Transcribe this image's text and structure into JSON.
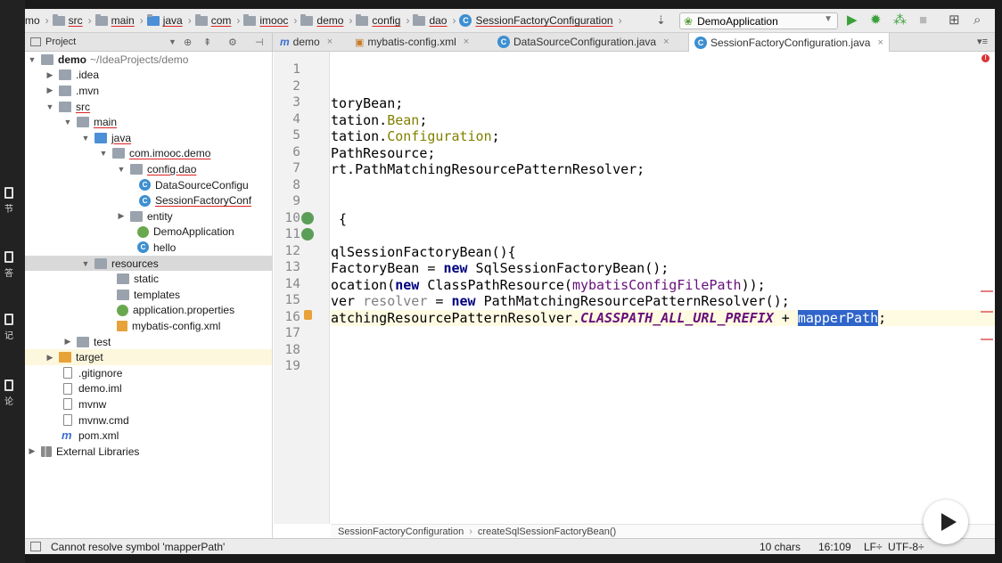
{
  "sidebar": {
    "items": [
      {
        "icon": "chapter-icon",
        "label": "节"
      },
      {
        "icon": "qa-icon",
        "label": "答"
      },
      {
        "icon": "notes-icon",
        "label": "记"
      },
      {
        "icon": "discuss-icon",
        "label": "论"
      }
    ]
  },
  "nav": {
    "crumbs": [
      "mo",
      "src",
      "main",
      "java",
      "com",
      "imooc",
      "demo",
      "config",
      "dao",
      "SessionFactoryConfiguration"
    ],
    "run_config": "DemoApplication"
  },
  "tabs": {
    "project_label": "Project",
    "items": [
      {
        "label": "demo",
        "icon": "m",
        "active": false
      },
      {
        "label": "mybatis-config.xml",
        "icon": "xml",
        "active": false
      },
      {
        "label": "DataSourceConfiguration.java",
        "icon": "class",
        "active": false
      },
      {
        "label": "SessionFactoryConfiguration.java",
        "icon": "class",
        "active": true
      }
    ]
  },
  "tree": {
    "rows": [
      {
        "label": "demo",
        "extra": "~/IdeaProjects/demo"
      },
      {
        "label": ".idea"
      },
      {
        "label": ".mvn"
      },
      {
        "label": "src"
      },
      {
        "label": "main"
      },
      {
        "label": "java"
      },
      {
        "label": "com.imooc.demo"
      },
      {
        "label": "config.dao"
      },
      {
        "label": "DataSourceConfigu"
      },
      {
        "label": "SessionFactoryConf"
      },
      {
        "label": "entity"
      },
      {
        "label": "DemoApplication"
      },
      {
        "label": "hello"
      },
      {
        "label": "resources"
      },
      {
        "label": "static"
      },
      {
        "label": "templates"
      },
      {
        "label": "application.properties"
      },
      {
        "label": "mybatis-config.xml"
      },
      {
        "label": "test"
      },
      {
        "label": "target"
      },
      {
        "label": ".gitignore"
      },
      {
        "label": "demo.iml"
      },
      {
        "label": "mvnw"
      },
      {
        "label": "mvnw.cmd"
      },
      {
        "label": "pom.xml"
      },
      {
        "label": "External Libraries"
      }
    ]
  },
  "editor": {
    "line_numbers": [
      "1",
      "2",
      "3",
      "4",
      "5",
      "6",
      "7",
      "8",
      "9",
      "10",
      "11",
      "12",
      "13",
      "14",
      "15",
      "16",
      "17",
      "18",
      "19"
    ],
    "l3": "toryBean;",
    "l4a": "tation.",
    "l4b": "Bean",
    "l4c": ";",
    "l5a": "tation.",
    "l5b": "Configuration",
    "l5c": ";",
    "l6": "PathResource;",
    "l7": "rt.PathMatchingResourcePatternResolver;",
    "l10": " {",
    "l12": "qlSessionFactoryBean(){",
    "l13a": "FactoryBean = ",
    "l13k": "new",
    "l13b": " SqlSessionFactoryBean();",
    "l14a": "ocation(",
    "l14k": "new",
    "l14b": " ClassPathResource(",
    "l14f": "mybatisConfigFilePath",
    "l14c": "));",
    "l15a": "ver ",
    "l15g": "resolver",
    "l15b": " = ",
    "l15k": "new",
    "l15c": " PathMatchingResourcePatternResolver();",
    "l16a": "atchingResourcePatternResolver.",
    "l16c": "CLASSPATH_ALL_URL_PREFIX",
    "l16b": " + ",
    "l16h": "mapperPath",
    "l16d": ";"
  },
  "editor_breadcrumb": [
    "SessionFactoryConfiguration",
    "createSqlSessionFactoryBean()"
  ],
  "status": {
    "message": "Cannot resolve symbol 'mapperPath'",
    "chars": "10 chars",
    "position": "16:109",
    "line_sep": "LF÷",
    "encoding": "UTF-8÷"
  }
}
